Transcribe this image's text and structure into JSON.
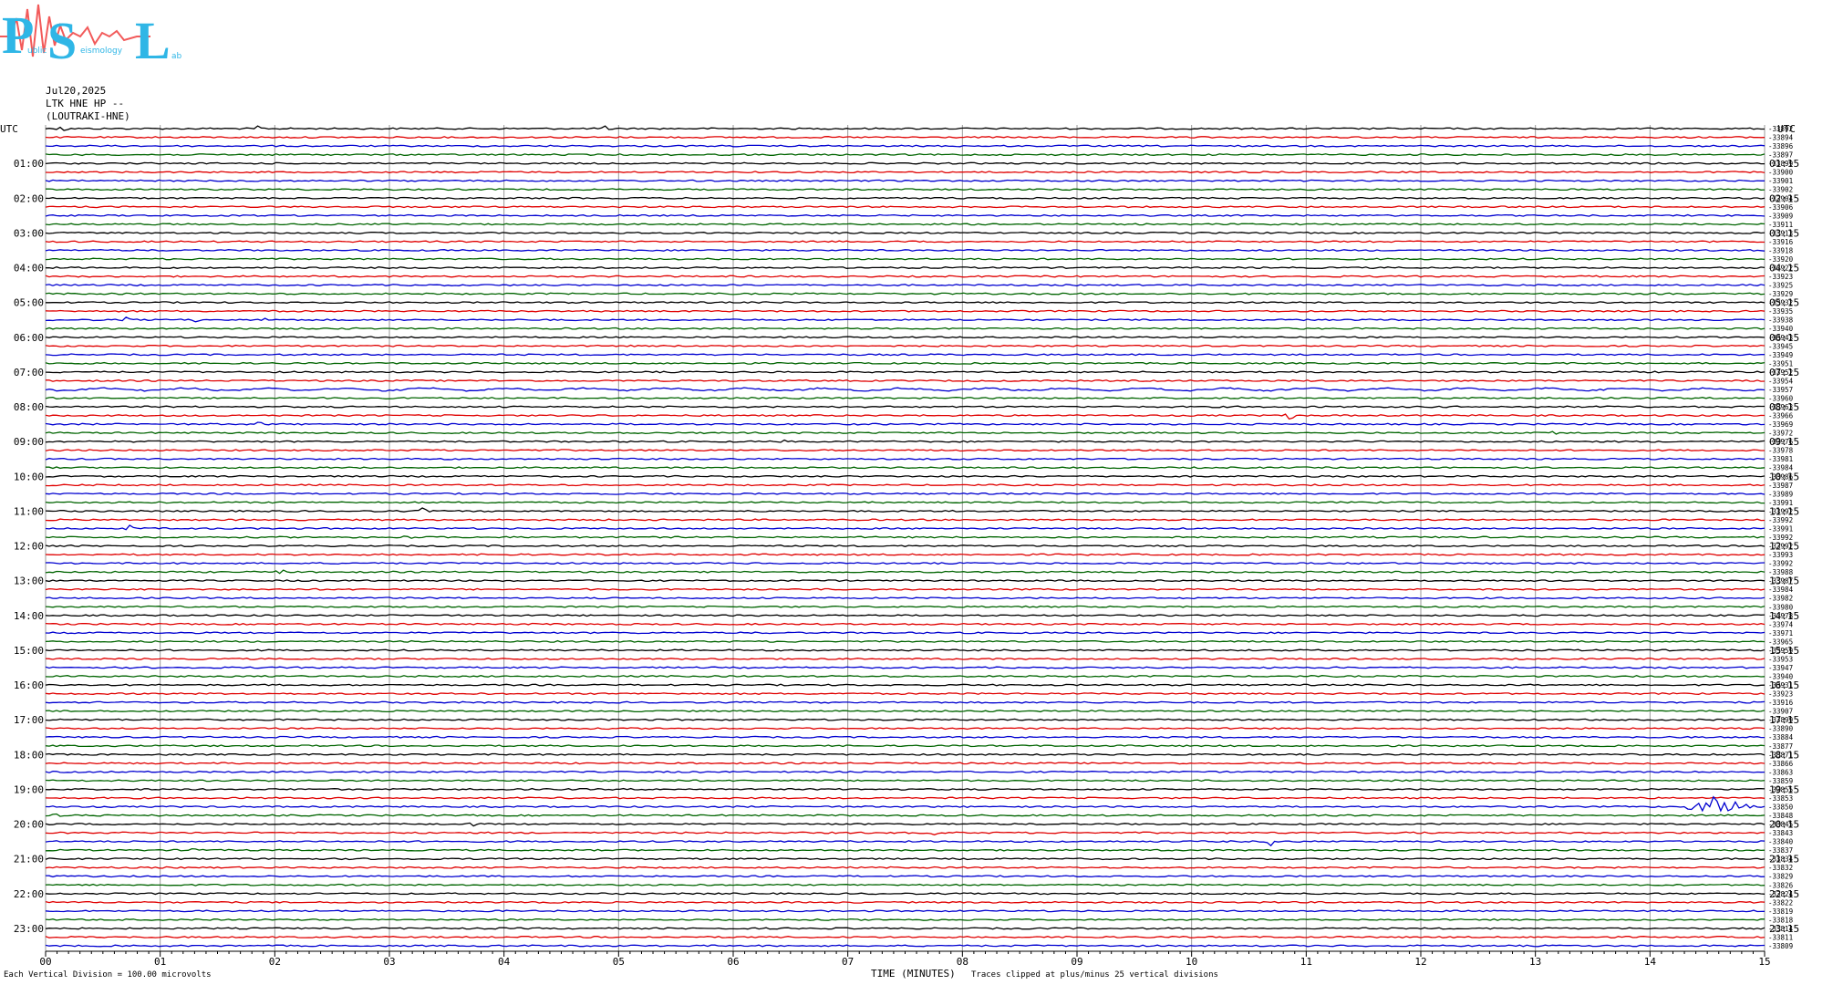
{
  "header": {
    "logo_letters": "PSL",
    "logo_words": [
      "ublic",
      "eismology",
      "ab"
    ],
    "date": "Jul20,2025",
    "station": "LTK HNE HP --",
    "location": "(LOUTRAKI-HNE)"
  },
  "colors": {
    "black": "#000000",
    "red": "#e00000",
    "blue": "#0000d0",
    "green": "#006400",
    "grid": "#9a9a9a",
    "logo_blue": "#2fb6e6",
    "logo_red": "#f25a5a"
  },
  "footer": {
    "division_note": "Each Vertical Division =  100.00 microvolts",
    "xlabel": "TIME (MINUTES)",
    "clip_note": "Traces clipped at plus/minus 25 vertical divisions"
  },
  "chart_data": {
    "type": "line",
    "title": "",
    "xlabel": "TIME (MINUTES)",
    "xlim": [
      0,
      15
    ],
    "x_ticks": [
      "00",
      "01",
      "02",
      "03",
      "04",
      "05",
      "06",
      "07",
      "08",
      "09",
      "10",
      "11",
      "12",
      "13",
      "14",
      "15"
    ],
    "utc_label_left": "UTC",
    "utc_label_right": "UTC",
    "left_hour_labels": [
      "01:00",
      "02:00",
      "03:00",
      "04:00",
      "05:00",
      "06:00",
      "07:00",
      "08:00",
      "09:00",
      "10:00",
      "11:00",
      "12:00",
      "13:00",
      "14:00",
      "15:00",
      "16:00",
      "17:00",
      "18:00",
      "19:00",
      "20:00",
      "21:00",
      "22:00",
      "23:00"
    ],
    "right_hour_labels": [
      "01:15",
      "02:15",
      "03:15",
      "04:15",
      "05:15",
      "06:15",
      "07:15",
      "08:15",
      "09:15",
      "10:15",
      "11:15",
      "12:15",
      "13:15",
      "14:15",
      "15:15",
      "16:15",
      "17:15",
      "18:15",
      "19:15",
      "20:15",
      "21:15",
      "22:15",
      "23:15"
    ],
    "trace_color_cycle": [
      "black",
      "red",
      "blue",
      "green"
    ],
    "trace_offsets": [
      "-33892",
      "-33894",
      "-33896",
      "-33897",
      "-33899",
      "-33900",
      "-33901",
      "-33902",
      "-33904",
      "-33906",
      "-33909",
      "-33911",
      "-33913",
      "-33916",
      "-33918",
      "-33920",
      "-33922",
      "-33923",
      "-33925",
      "-33929",
      "-33932",
      "-33935",
      "-33938",
      "-33940",
      "-33943",
      "-33945",
      "-33949",
      "-33951",
      "-33952",
      "-33954",
      "-33957",
      "-33960",
      "-33963",
      "-33966",
      "-33969",
      "-33972",
      "-33976",
      "-33978",
      "-33981",
      "-33984",
      "-33986",
      "-33987",
      "-33989",
      "-33991",
      "-33992",
      "-33992",
      "-33991",
      "-33992",
      "-33992",
      "-33993",
      "-33992",
      "-33988",
      "-33987",
      "-33984",
      "-33982",
      "-33980",
      "-33978",
      "-33974",
      "-33971",
      "-33965",
      "-33959",
      "-33953",
      "-33947",
      "-33940",
      "-33931",
      "-33923",
      "-33916",
      "-33907",
      "-33899",
      "-33890",
      "-33884",
      "-33877",
      "-33871",
      "-33866",
      "-33863",
      "-33859",
      "-33855",
      "-33853",
      "-33850",
      "-33848",
      "-33845",
      "-33843",
      "-33840",
      "-33837",
      "-33834",
      "-33832",
      "-33829",
      "-33826",
      "-33824",
      "-33822",
      "-33819",
      "-33818",
      "-33814",
      "-33811",
      "-33809"
    ],
    "events": [
      {
        "trace": 0,
        "x": 0.15,
        "amp": 4
      },
      {
        "trace": 0,
        "x": 1.85,
        "amp": 5
      },
      {
        "trace": 0,
        "x": 4.9,
        "amp": 4
      },
      {
        "trace": 1,
        "x": 2.95,
        "amp": 3
      },
      {
        "trace": 22,
        "x": 0.7,
        "amp": 3
      },
      {
        "trace": 22,
        "x": 1.3,
        "amp": 3
      },
      {
        "trace": 22,
        "x": 1.9,
        "amp": 3
      },
      {
        "trace": 33,
        "x": 10.85,
        "amp": 6
      },
      {
        "trace": 34,
        "x": 1.85,
        "amp": 3
      },
      {
        "trace": 35,
        "x": 13.15,
        "amp": 6
      },
      {
        "trace": 36,
        "x": 6.45,
        "amp": 3
      },
      {
        "trace": 36,
        "x": 11.45,
        "amp": 3
      },
      {
        "trace": 44,
        "x": 3.3,
        "amp": 4
      },
      {
        "trace": 46,
        "x": 0.75,
        "amp": 4
      },
      {
        "trace": 47,
        "x": 3.15,
        "amp": 4
      },
      {
        "trace": 51,
        "x": 2.05,
        "amp": 4
      },
      {
        "trace": 78,
        "x": 14.6,
        "amp": 14
      },
      {
        "trace": 79,
        "x": 0.1,
        "amp": 3
      },
      {
        "trace": 80,
        "x": 3.7,
        "amp": 3
      },
      {
        "trace": 81,
        "x": 7.75,
        "amp": 4
      },
      {
        "trace": 81,
        "x": 12.0,
        "amp": 3
      },
      {
        "trace": 82,
        "x": 10.7,
        "amp": 5
      },
      {
        "trace": 83,
        "x": 1.3,
        "amp": 4
      }
    ]
  }
}
